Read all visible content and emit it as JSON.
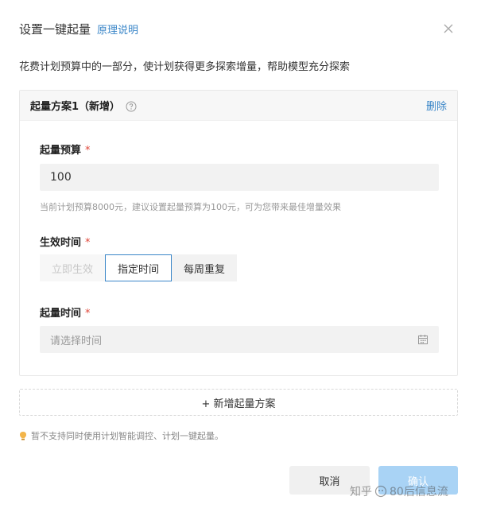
{
  "dialog": {
    "title": "设置一键起量",
    "title_link": "原理说明",
    "description": "花费计划预算中的一部分，使计划获得更多探索增量，帮助模型充分探索"
  },
  "plan": {
    "title": "起量方案1（新增）",
    "delete_label": "删除",
    "budget_label": "起量预算",
    "budget_value": "100",
    "budget_hint": "当前计划预算8000元，建议设置起量预算为100元，可为您带来最佳增量效果",
    "effect_label": "生效时间",
    "effect_options": [
      "立即生效",
      "指定时间",
      "每周重复"
    ],
    "effect_selected": "指定时间",
    "start_label": "起量时间",
    "start_placeholder": "请选择时间",
    "required_mark": "*"
  },
  "add_plan_label": "+ 新增起量方案",
  "tip": "暂不支持同时使用计划智能调控、计划一键起量。",
  "footer": {
    "cancel_label": "取消",
    "confirm_label": "确认"
  },
  "watermark": {
    "left": "知乎",
    "right": "80后信息流"
  },
  "colors": {
    "accent": "#3a86c8",
    "required": "#e0483b",
    "confirm_disabled": "#a9d3f5"
  }
}
